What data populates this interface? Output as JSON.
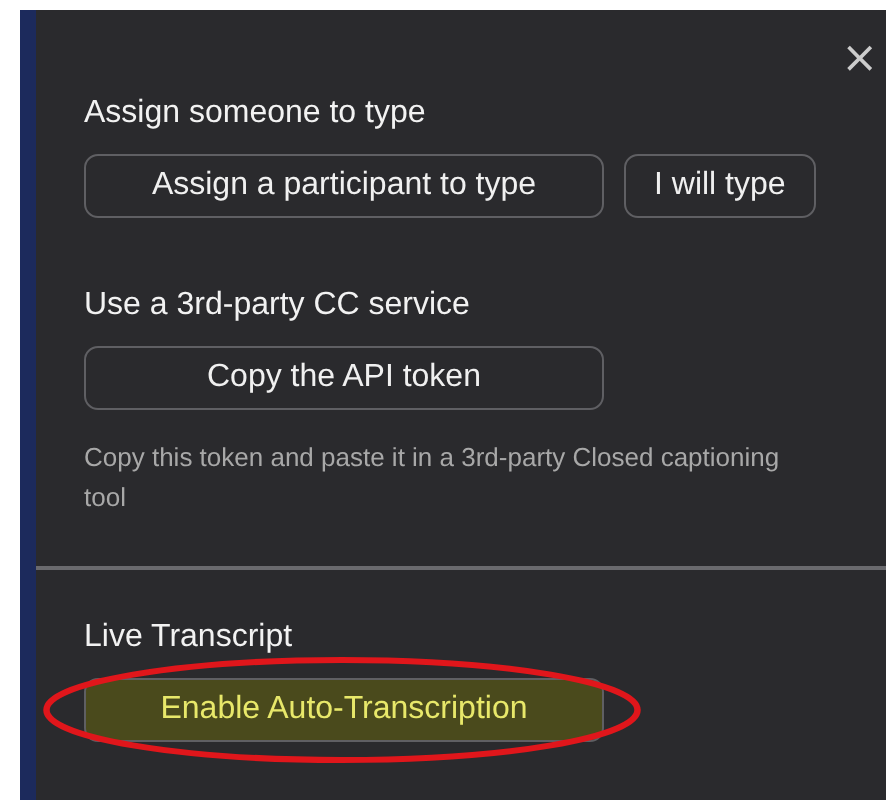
{
  "close_button": {
    "label": "×"
  },
  "sections": [
    {
      "heading": "Assign someone to type",
      "buttons": [
        {
          "label": "Assign a participant to type",
          "highlighted": false,
          "circled": false
        },
        {
          "label": "I will type",
          "highlighted": false,
          "circled": false
        }
      ]
    },
    {
      "heading": "Use a 3rd-party CC service",
      "buttons": [
        {
          "label": "Copy the API token",
          "highlighted": false,
          "circled": false
        }
      ],
      "description": "Copy this token and paste it in a 3rd-party Closed captioning tool"
    },
    {
      "heading": "Live Transcript",
      "buttons": [
        {
          "label": "Enable Auto-Transcription",
          "highlighted": true,
          "circled": true
        }
      ]
    }
  ]
}
